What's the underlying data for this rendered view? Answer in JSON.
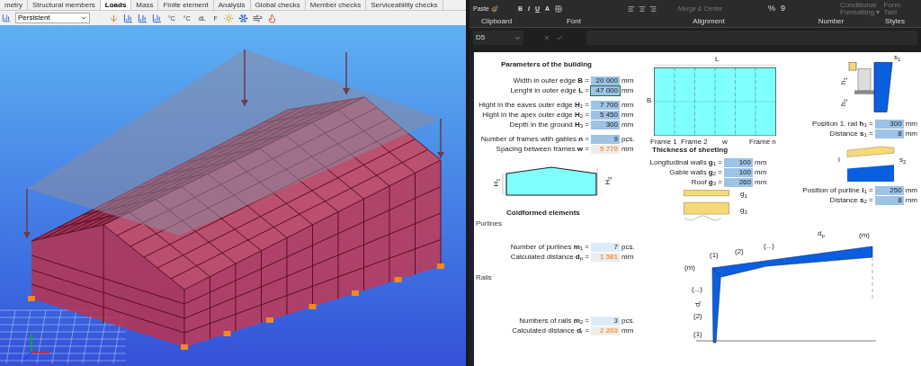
{
  "app3d": {
    "tabs": [
      {
        "label": "metry",
        "selected": false
      },
      {
        "label": "Structural members",
        "selected": false
      },
      {
        "label": "Loads",
        "selected": true
      },
      {
        "label": "Mass",
        "selected": false
      },
      {
        "label": "Finite element",
        "selected": false
      },
      {
        "label": "Analysis",
        "selected": false
      },
      {
        "label": "Global checks",
        "selected": false
      },
      {
        "label": "Member checks",
        "selected": false
      },
      {
        "label": "Serviceability checks",
        "selected": false
      }
    ],
    "load_case": "Persistent",
    "tool_texts": [
      "°C",
      "°C",
      "dL",
      "F"
    ]
  },
  "excel": {
    "paste": "Paste",
    "font_buttons": [
      "B",
      "I",
      "U",
      "A"
    ],
    "merge": {
      "label": "Merge & Center",
      "disabled": true
    },
    "number_buttons": [
      "%",
      "9"
    ],
    "styles": [
      {
        "line1": "Conditional",
        "line2": "Formatting ▾",
        "disabled": true
      },
      {
        "line1": "Form",
        "line2": "Tabl",
        "disabled": true
      }
    ],
    "groups": [
      "Clipboard",
      "Font",
      "Alignment",
      "Number",
      "Styles"
    ],
    "name_box": "D5"
  },
  "sheet": {
    "building": {
      "title": "Parameters of the building",
      "groups": [
        [
          {
            "label": "Width in outer edge **B** =",
            "value": "20 000",
            "unit": "mm",
            "kind": "input",
            "selected": false
          },
          {
            "label": "Lenght in outer edge **L** =",
            "value": "47 000",
            "unit": "mm",
            "kind": "input",
            "selected": true
          }
        ],
        [
          {
            "label": "Hight in the eaves outer edge **H**$_{1}$ =",
            "value": "7 700",
            "unit": "mm",
            "kind": "input",
            "selected": false
          },
          {
            "label": "Hight in the apex outer edge **H**$_{2}$ =",
            "value": "5 450",
            "unit": "mm",
            "kind": "input",
            "selected": false
          },
          {
            "label": "Depth in the ground **H**$_{3}$ =",
            "value": "300",
            "unit": "mm",
            "kind": "input",
            "selected": false
          }
        ],
        [
          {
            "label": "Number of frames with gables **n** =",
            "value": "9",
            "unit": "pcs.",
            "kind": "input",
            "selected": false
          },
          {
            "label": "Spacing between frames **w** =",
            "value": "5 770",
            "unit": "mm",
            "kind": "result",
            "selected": false
          }
        ]
      ]
    },
    "gable_labels": [
      "H$_{1}$",
      "H$_{2}$"
    ],
    "plan_labels": [
      "L",
      "B",
      "Frame 1",
      "Frame 2",
      "w",
      "Frame n"
    ],
    "sheeting": {
      "title": "Thickness of sheeting",
      "rows": [
        {
          "label": "Longitudinal walls **g**$_{1}$ =",
          "value": "100",
          "unit": "mm",
          "kind": "input",
          "selected": false
        },
        {
          "label": "Gable walls **g**$_{2}$ =",
          "value": "100",
          "unit": "mm",
          "kind": "input",
          "selected": false
        },
        {
          "label": "Roof **g**$_{3}$ =",
          "value": "260",
          "unit": "mm",
          "kind": "input",
          "selected": false
        }
      ],
      "drawing_labels": [
        "g$_{1}$",
        "g$_{3}$"
      ]
    },
    "rail_detail": {
      "labels": [
        "s$_{1}$",
        "h$_{1}$",
        "h$_{3}$"
      ],
      "rows": [
        {
          "label": "Position 1. rail **h**$_{1}$ =",
          "value": "300",
          "unit": "mm",
          "kind": "input",
          "selected": false
        },
        {
          "label": "Distance **s**$_{1}$ =",
          "value": "8",
          "unit": "mm",
          "kind": "input",
          "selected": false
        }
      ]
    },
    "purline_detail": {
      "labels": [
        "l",
        "s$_{2}$"
      ],
      "rows": [
        {
          "label": "Position of purline **l**$_{1}$ =",
          "value": "250",
          "unit": "mm",
          "kind": "input",
          "selected": false
        },
        {
          "label": "Distance **s**$_{2}$ =",
          "value": "8",
          "unit": "mm",
          "kind": "input",
          "selected": false
        }
      ]
    },
    "coldformed": {
      "title": "Coldformed elements",
      "purlines": {
        "heading": "Purlines",
        "rows": [
          {
            "label": "Number of purlines **m**$_{1}$ =",
            "value": "7",
            "unit": "pcs.",
            "kind": "count",
            "selected": false
          },
          {
            "label": "Calculated distance **d**$_{p}$ =",
            "value": "1 581",
            "unit": "mm",
            "kind": "result",
            "selected": false
          }
        ]
      },
      "rails": {
        "heading": "Rails",
        "rows": [
          {
            "label": "Numbers of rails **m**$_{2}$ =",
            "value": "3",
            "unit": "pcs.",
            "kind": "count",
            "selected": false
          },
          {
            "label": "Calculated distance **d**$_{r}$ =",
            "value": "2 203",
            "unit": "mm",
            "kind": "result",
            "selected": false
          }
        ]
      }
    },
    "frame_labels": [
      "(m)",
      "(1)",
      "(2)",
      "(...)",
      "d$_{p}$",
      "(m)",
      "(...)",
      "d$_{r}$",
      "(2)",
      "(1)"
    ]
  }
}
